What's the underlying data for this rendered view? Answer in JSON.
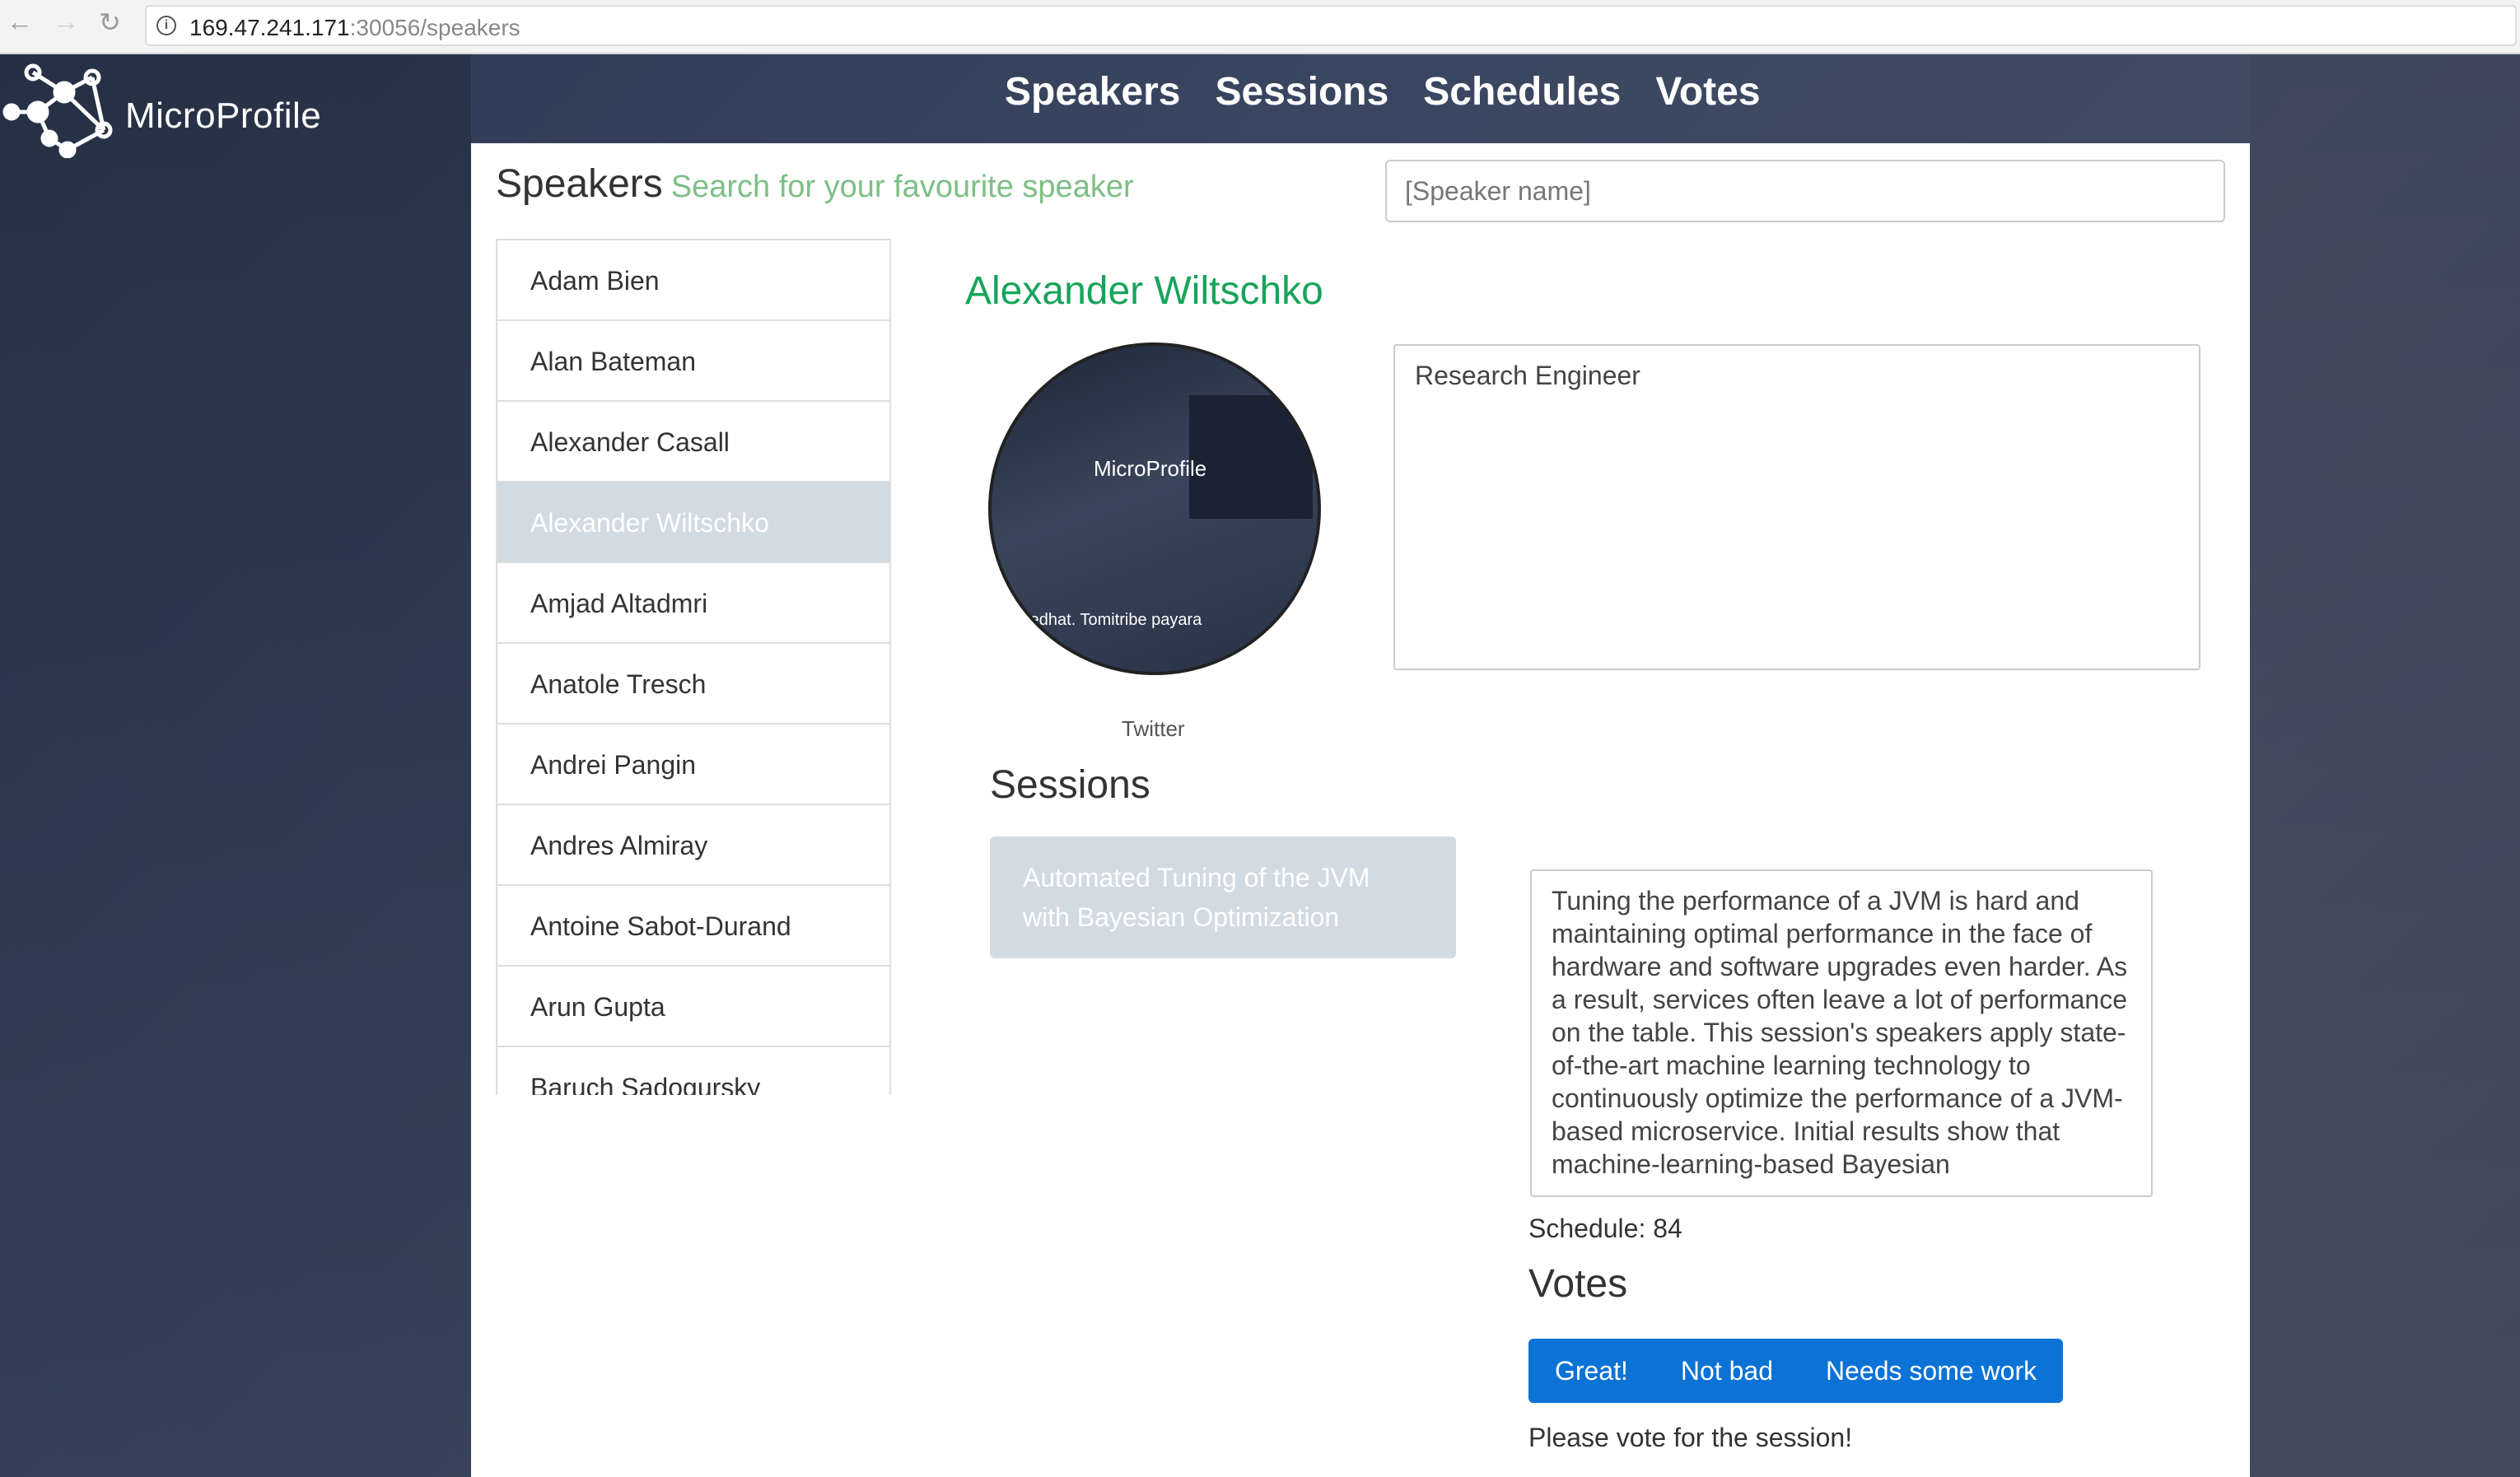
{
  "browser": {
    "url_host": "169.47.241.171",
    "url_path": ":30056/speakers"
  },
  "brand": {
    "name": "MicroProfile"
  },
  "nav": {
    "items": [
      "Speakers",
      "Sessions",
      "Schedules",
      "Votes"
    ]
  },
  "page": {
    "title": "Speakers",
    "subtitle": "Search for your favourite speaker",
    "search_placeholder": "[Speaker name]"
  },
  "speakers": [
    "Adam Bien",
    "Alan Bateman",
    "Alexander Casall",
    "Alexander Wiltschko",
    "Amjad Altadmri",
    "Anatole Tresch",
    "Andrei Pangin",
    "Andres Almiray",
    "Antoine Sabot-Durand",
    "Arun Gupta",
    "Baruch Sadogursky"
  ],
  "selected_speaker_index": 3,
  "speaker": {
    "name": "Alexander Wiltschko",
    "bio": "Research Engineer",
    "twitter_label": "Twitter",
    "photo_logo_text": "MicroProfile",
    "photo_sponsors": "redhat.  Tomitribe  payara"
  },
  "sessions": {
    "title": "Sessions",
    "items": [
      {
        "title": "Automated Tuning of the JVM with Bayesian Optimization",
        "description": "Tuning the performance of a JVM is hard and maintaining optimal performance in the face of hardware and software upgrades even harder. As a result, services often leave a lot of performance on the table. This session's speakers apply state-of-the-art machine learning technology to continuously optimize the performance of a JVM-based microservice. Initial results show that machine-learning-based Bayesian",
        "schedule_label": "Schedule: 84"
      }
    ]
  },
  "votes": {
    "title": "Votes",
    "buttons": [
      "Great!",
      "Not bad",
      "Needs some work"
    ],
    "message": "Please vote for the session!"
  },
  "colors": {
    "accent_green": "#17a45a",
    "subtitle_green": "#7dbf86",
    "active_item": "#d3dbe2",
    "vote_blue": "#0b72d6"
  }
}
